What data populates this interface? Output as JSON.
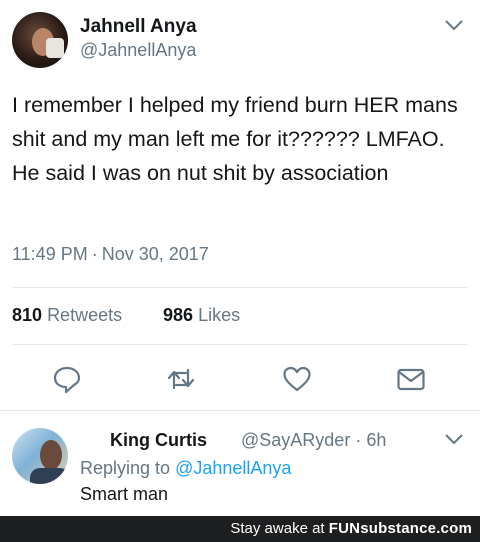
{
  "tweet": {
    "author_name": "Jahnell Anya",
    "author_handle": "@JahnellAnya",
    "text": "I remember I helped my friend burn HER mans shit and my man left me for it?????? LMFAO. He said I was on nut shit by association",
    "time": "11:49 PM",
    "separator": "·",
    "date": "Nov 30, 2017",
    "retweets_count": "810",
    "retweets_label": "Retweets",
    "likes_count": "986",
    "likes_label": "Likes",
    "actions": [
      "reply-icon",
      "retweet-icon",
      "heart-icon",
      "mail-icon"
    ]
  },
  "reply": {
    "author_name": "King Curtis",
    "author_handle": "@SayARyder",
    "separator": "·",
    "age": "6h",
    "replying_prefix": "Replying to",
    "replying_to": "@JahnellAnya",
    "text": "Smart man"
  },
  "footer": {
    "prefix": "Stay awake at",
    "brand": "FUNsubstance.com"
  },
  "colors": {
    "text": "#14171a",
    "secondary": "#657786",
    "link": "#1da1f2",
    "divider": "#e1e8ed",
    "footer_bg": "#1e1f21"
  }
}
